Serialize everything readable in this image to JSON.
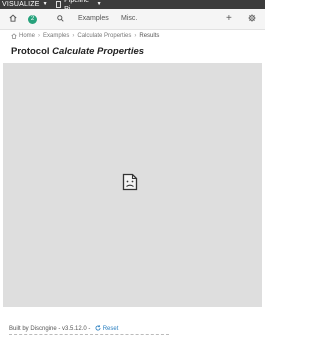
{
  "topbar": {
    "app_name": "VISUALIZE",
    "pipeline_tab": "Pipeline Pi..."
  },
  "nav": {
    "badge_count": "2",
    "examples_label": "Examples",
    "misc_label": "Misc.",
    "add_label": "+"
  },
  "breadcrumb": {
    "home": "Home",
    "examples": "Examples",
    "calculate": "Calculate Properties",
    "current": "Results"
  },
  "page": {
    "title_prefix": "Protocol",
    "title_name": "Calculate Properties"
  },
  "footer": {
    "built_by": "Built by Discngine - v3.5.12.0 -",
    "reset_label": "Reset"
  },
  "colors": {
    "badge": "#27a27c",
    "link": "#2a7fc0",
    "topbar": "#3c3c3c",
    "content_bg": "#dedede"
  }
}
